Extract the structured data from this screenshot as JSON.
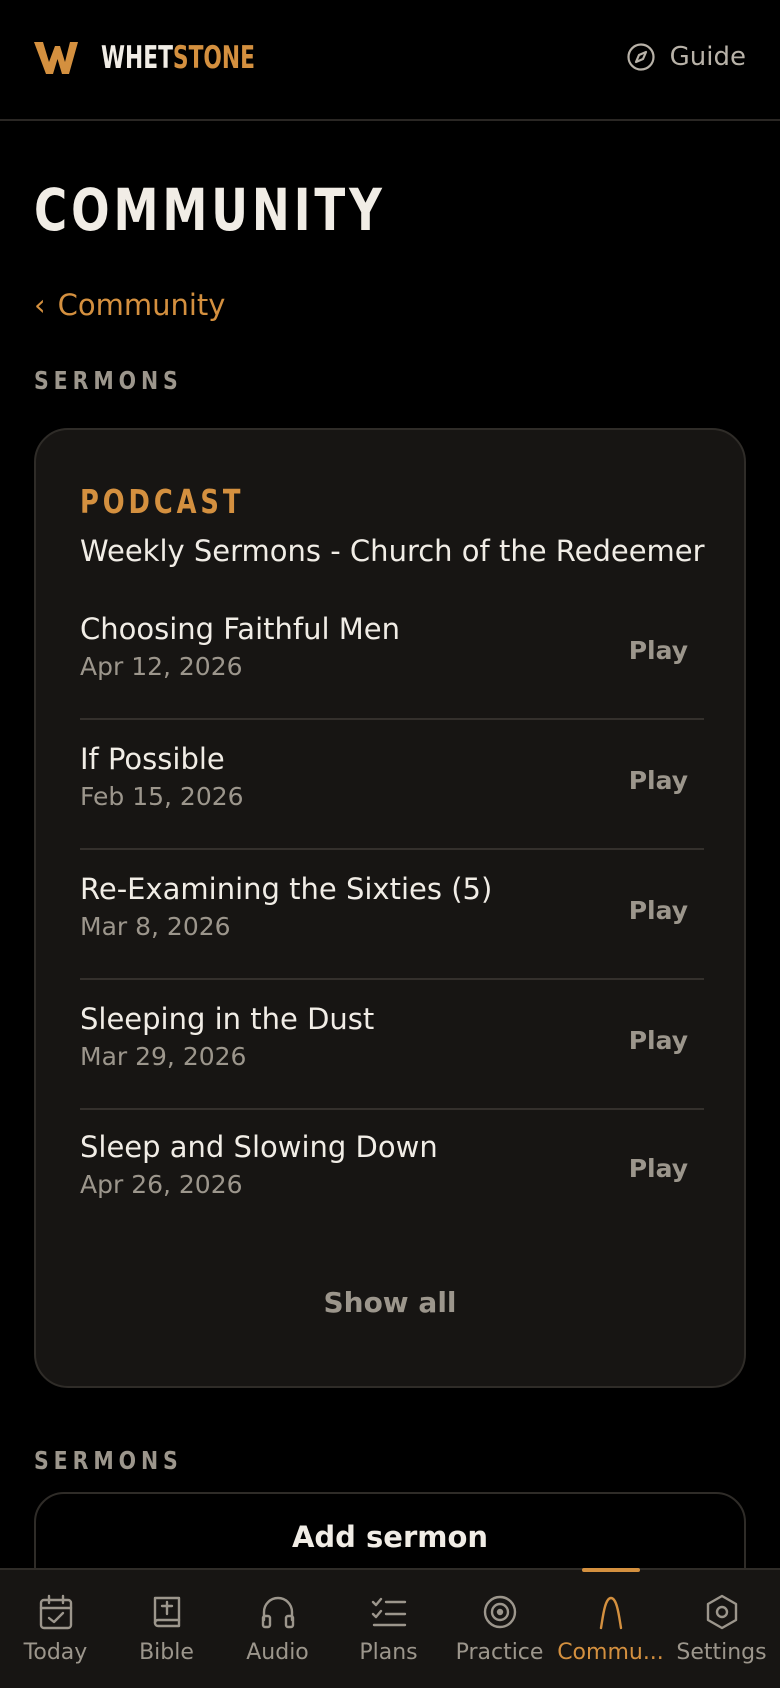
{
  "header": {
    "brand_part1": "WHET",
    "brand_part2": "STONE",
    "guide_label": "Guide",
    "accent_color": "#d4903f"
  },
  "page": {
    "title": "COMMUNITY",
    "back_label": "Community"
  },
  "sermons_section": {
    "label": "SERMONS",
    "card": {
      "kind_label": "PODCAST",
      "podcast_title": "Weekly Sermons - Church of the Redeemer",
      "episodes": [
        {
          "title": "Choosing Faithful Men",
          "date": "Apr 12, 2026",
          "action": "Play"
        },
        {
          "title": "If Possible",
          "date": "Feb 15, 2026",
          "action": "Play"
        },
        {
          "title": "Re-Examining the Sixties (5)",
          "date": "Mar 8, 2026",
          "action": "Play"
        },
        {
          "title": "Sleeping in the Dust",
          "date": "Mar 29, 2026",
          "action": "Play"
        },
        {
          "title": "Sleep and Slowing Down",
          "date": "Apr 26, 2026",
          "action": "Play"
        }
      ],
      "show_all_label": "Show all"
    }
  },
  "sermons_section_2": {
    "label": "SERMONS",
    "add_label": "Add sermon"
  },
  "tabbar": {
    "active": "community",
    "tabs": [
      {
        "id": "today",
        "label": "Today",
        "icon": "calendar-check-icon"
      },
      {
        "id": "bible",
        "label": "Bible",
        "icon": "bible-icon"
      },
      {
        "id": "audio",
        "label": "Audio",
        "icon": "headphones-icon"
      },
      {
        "id": "plans",
        "label": "Plans",
        "icon": "checklist-icon"
      },
      {
        "id": "practice",
        "label": "Practice",
        "icon": "target-icon"
      },
      {
        "id": "community",
        "label": "Commu...",
        "icon": "arch-icon"
      },
      {
        "id": "settings",
        "label": "Settings",
        "icon": "hexagon-settings-icon"
      }
    ]
  }
}
